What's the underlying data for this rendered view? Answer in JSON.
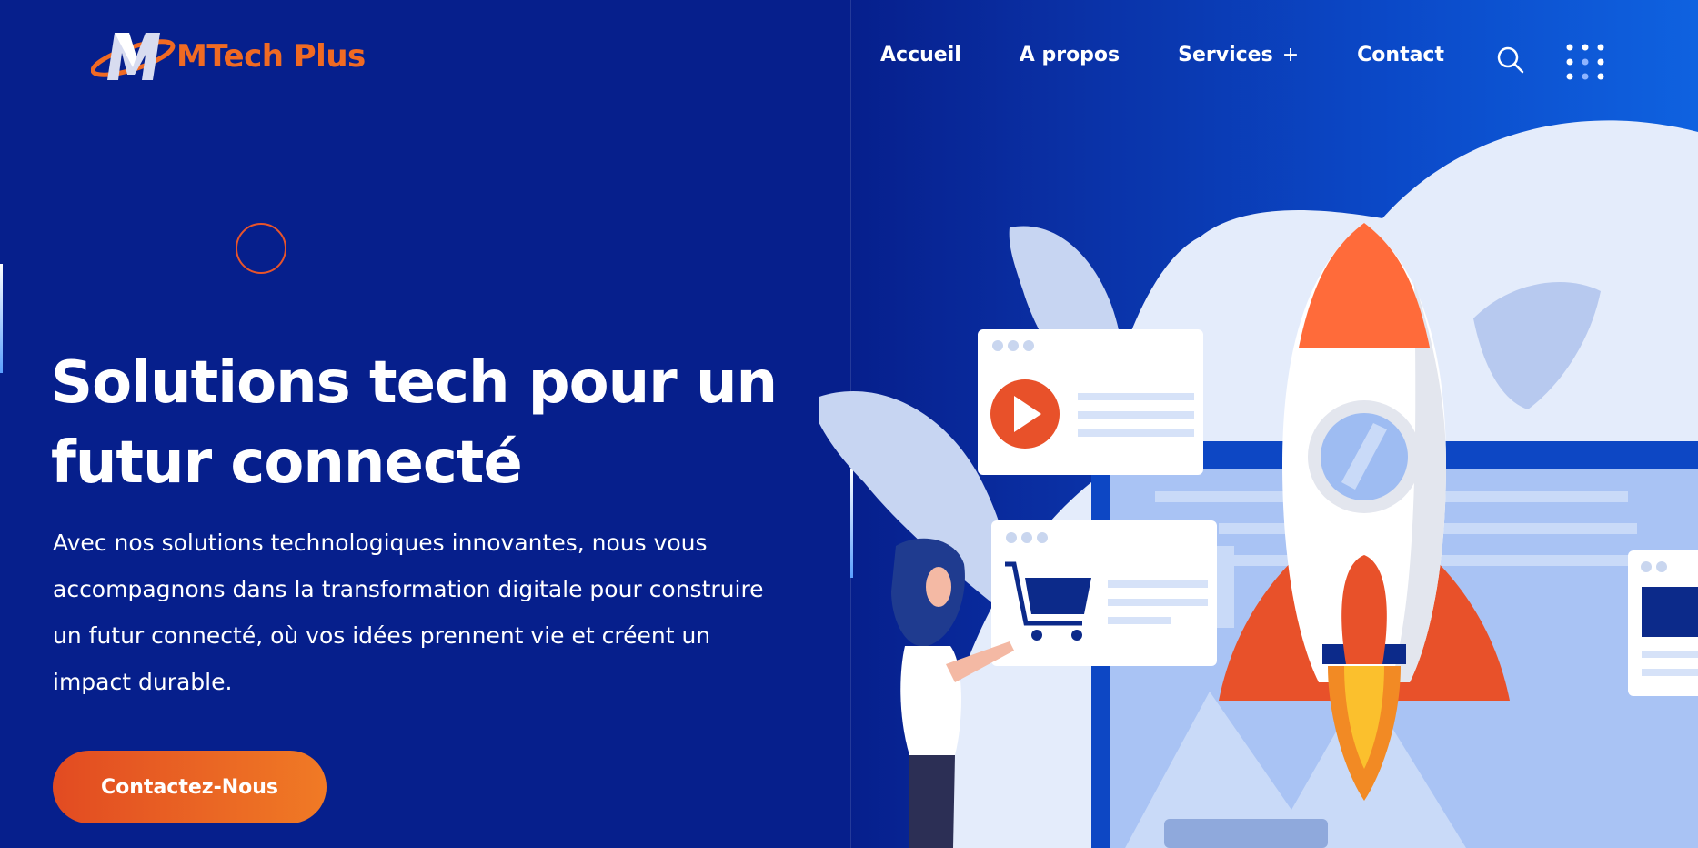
{
  "header": {
    "logo_text": "MTech Plus",
    "nav": [
      {
        "label": "Accueil"
      },
      {
        "label": "A propos"
      },
      {
        "label": "Services",
        "suffix": "+"
      },
      {
        "label": "Contact"
      }
    ],
    "icons": {
      "search": "search-icon",
      "menu": "grid-menu-icon"
    }
  },
  "hero": {
    "title_line1": "Solutions tech pour un",
    "title_line2": "futur connecté",
    "description": "Avec nos solutions technologiques innovantes, nous vous accompagnons dans la transformation digitale pour construire un futur connecté, où vos idées prennent vie et créent un impact durable.",
    "cta_label": "Contactez-Nous"
  },
  "colors": {
    "background": "#061f8c",
    "accent": "#f06a23",
    "text": "#ffffff"
  }
}
